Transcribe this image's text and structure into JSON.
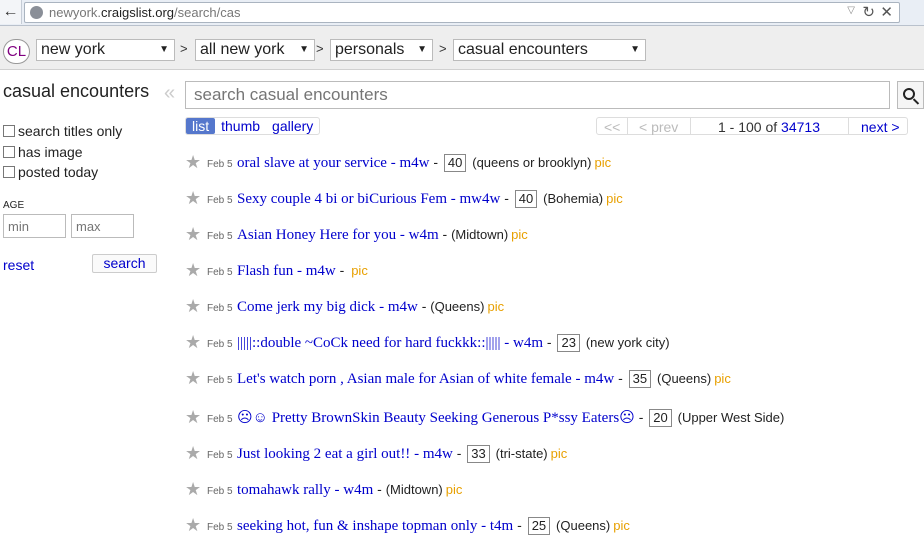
{
  "browser": {
    "url_prefix": "newyork.",
    "url_host": "craigslist.org",
    "url_path": "/search/cas"
  },
  "header": {
    "logo": "CL",
    "crumbs": [
      "new york",
      "all new york",
      "personals",
      "casual encounters"
    ],
    "separator": ">"
  },
  "sidebar": {
    "title": "casual encounters",
    "options": [
      "search titles only",
      "has image",
      "posted today"
    ],
    "age_label": "AGE",
    "min_placeholder": "min",
    "max_placeholder": "max",
    "reset_label": "reset",
    "search_label": "search"
  },
  "search": {
    "placeholder": "search casual encounters"
  },
  "views": [
    "list",
    "thumb",
    "gallery"
  ],
  "pager": {
    "first": "<<",
    "prev": "< prev",
    "range": "1 - 100 of",
    "total": "34713",
    "next": "next >"
  },
  "listings": [
    {
      "date": "Feb 5",
      "title": "oral slave at your service",
      "cat": "m4w",
      "age": "40",
      "loc": "(queens or brooklyn)",
      "pic": "pic"
    },
    {
      "date": "Feb 5",
      "title": "Sexy couple 4 bi or biCurious Fem",
      "cat": "mw4w",
      "age": "40",
      "loc": "(Bohemia)",
      "pic": "pic"
    },
    {
      "date": "Feb 5",
      "title": "Asian Honey Here for you",
      "cat": "w4m",
      "age": "",
      "loc": "(Midtown)",
      "pic": "pic"
    },
    {
      "date": "Feb 5",
      "title": "Flash fun",
      "cat": "m4w",
      "age": "",
      "loc": "",
      "pic": "pic"
    },
    {
      "date": "Feb 5",
      "title": "Come jerk my big dick",
      "cat": "m4w",
      "age": "",
      "loc": "(Queens)",
      "pic": "pic"
    },
    {
      "date": "Feb 5",
      "title": "|||||::double ~CoCk need for hard fuckkk::|||||",
      "cat": "w4m",
      "age": "23",
      "loc": "(new york city)",
      "pic": ""
    },
    {
      "date": "Feb 5",
      "title": "Let's watch porn , Asian male for Asian of white female",
      "cat": "m4w",
      "age": "35",
      "loc": "(Queens)",
      "pic": "pic"
    },
    {
      "date": "Feb 5",
      "title": "☹☺ Pretty BrownSkin Beauty Seeking Generous P*ssy Eaters☹",
      "cat": "",
      "age": "20",
      "loc": "(Upper West Side)",
      "pic": ""
    },
    {
      "date": "Feb 5",
      "title": "Just looking 2 eat a girl out!!",
      "cat": "m4w",
      "age": "33",
      "loc": "(tri-state)",
      "pic": "pic"
    },
    {
      "date": "Feb 5",
      "title": "tomahawk rally",
      "cat": "w4m",
      "age": "",
      "loc": "(Midtown)",
      "pic": "pic"
    },
    {
      "date": "Feb 5",
      "title": "seeking hot, fun & inshape topman only",
      "cat": "t4m",
      "age": "25",
      "loc": "(Queens)",
      "pic": "pic"
    }
  ]
}
